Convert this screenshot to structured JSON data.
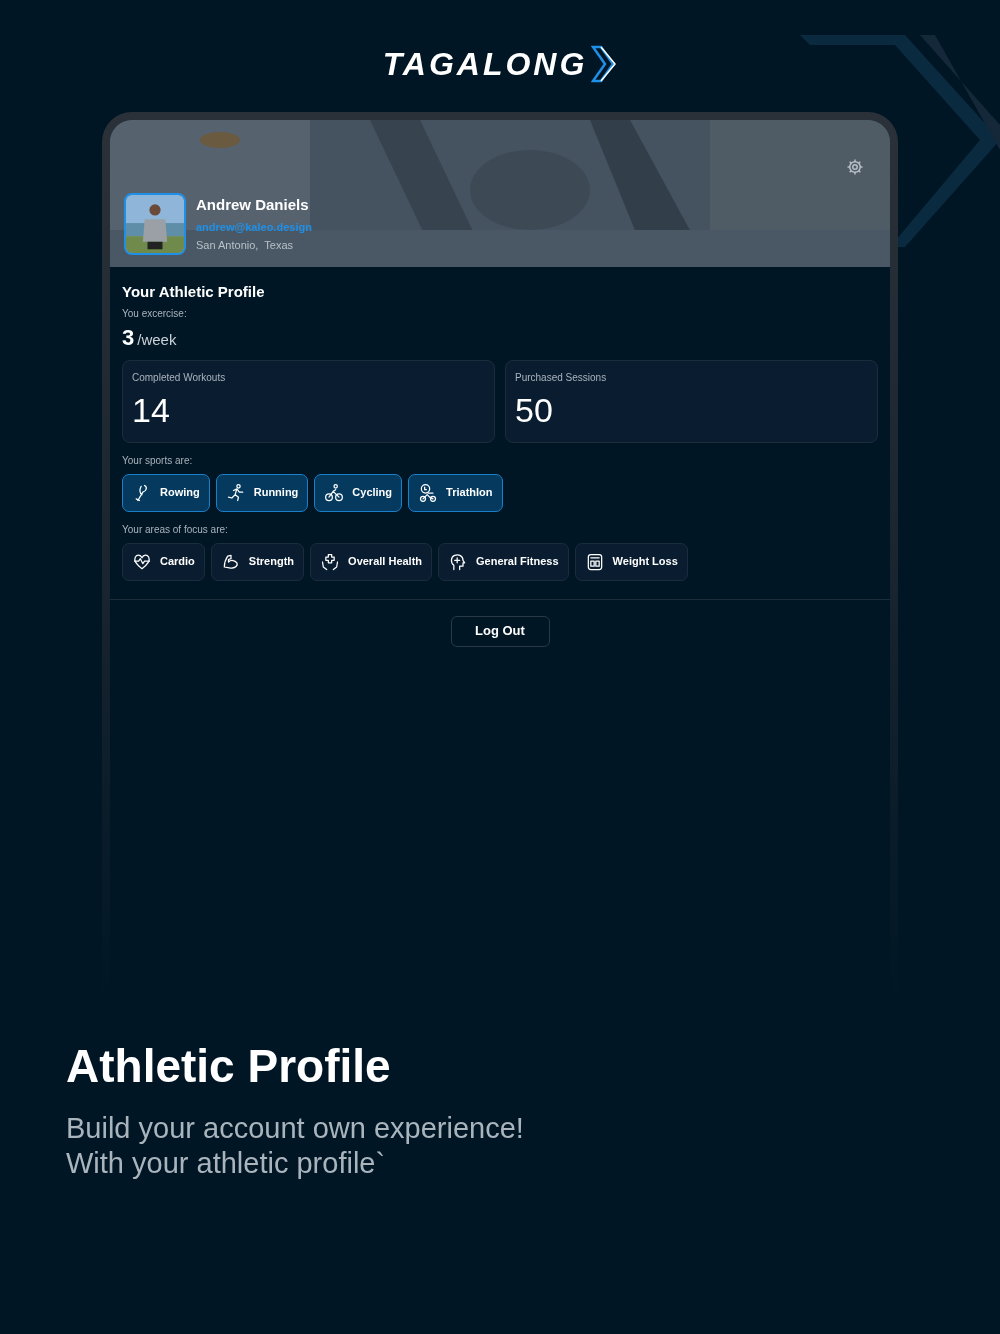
{
  "brand": {
    "logo_text": "TAGALONG"
  },
  "profile": {
    "name": "Andrew Daniels",
    "email": "andrew@kaleo.design",
    "location": "San Antonio,  Texas"
  },
  "athletic_profile": {
    "title": "Your Athletic Profile",
    "exercise_label": "You excercise:",
    "exercise_count": "3",
    "exercise_unit": "/week",
    "stats": [
      {
        "label": "Completed Workouts",
        "value": "14"
      },
      {
        "label": "Purchased Sessions",
        "value": "50"
      }
    ],
    "sports_label": "Your sports are:",
    "sports": [
      {
        "label": "Rowing",
        "kind": "rowing",
        "selected": true
      },
      {
        "label": "Running",
        "kind": "running",
        "selected": true
      },
      {
        "label": "Cycling",
        "kind": "cycling",
        "selected": true
      },
      {
        "label": "Triathlon",
        "kind": "triathlon",
        "selected": true
      }
    ],
    "focus_label": "Your areas of focus are:",
    "focus": [
      {
        "label": "Cardio",
        "kind": "heart",
        "selected": false
      },
      {
        "label": "Strength",
        "kind": "arm",
        "selected": false
      },
      {
        "label": "Overall Health",
        "kind": "health",
        "selected": false
      },
      {
        "label": "General Fitness",
        "kind": "head",
        "selected": false
      },
      {
        "label": "Weight Loss",
        "kind": "scale",
        "selected": false
      }
    ]
  },
  "logout_button": "Log Out",
  "caption": {
    "title": "Athletic Profile",
    "subtitle_lines": [
      "Build your account own experience!",
      "With your athletic profile`"
    ]
  }
}
